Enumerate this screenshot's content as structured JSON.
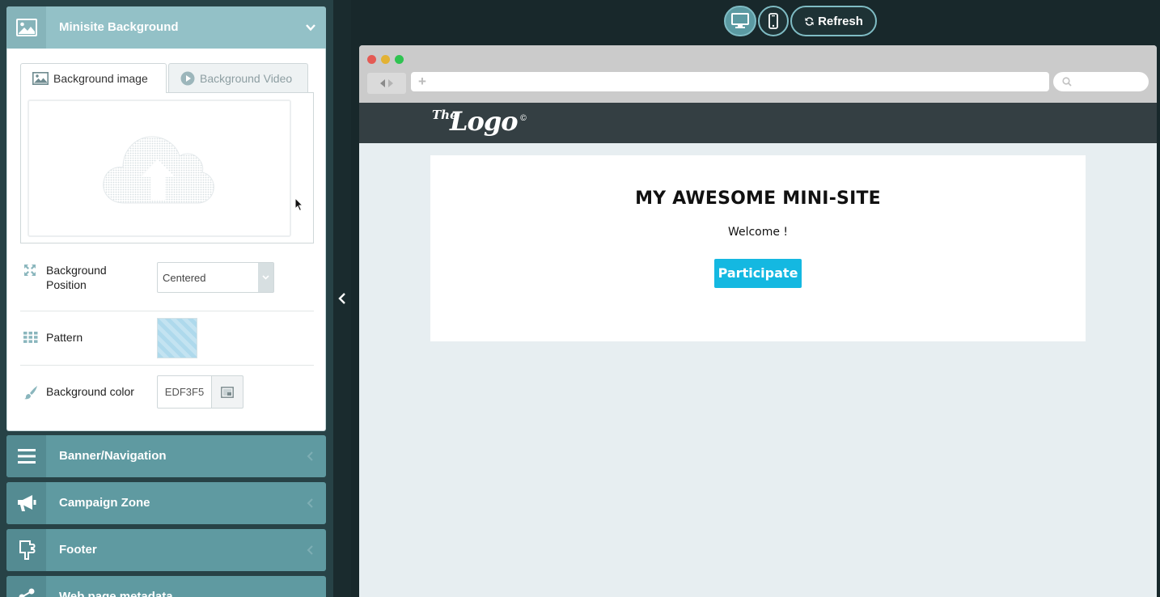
{
  "panel": {
    "sections": [
      {
        "title": "Minisite Background",
        "icon": "image-icon",
        "expanded": true
      },
      {
        "title": "Banner/Navigation",
        "icon": "menu-icon"
      },
      {
        "title": "Campaign Zone",
        "icon": "megaphone-icon"
      },
      {
        "title": "Footer",
        "icon": "footer-icon"
      },
      {
        "title": "Web page metadata",
        "icon": "share-icon"
      }
    ],
    "tabs": {
      "image": "Background image",
      "video": "Background Video"
    },
    "fields": {
      "position_label": "Background Position",
      "position_value": "Centered",
      "pattern_label": "Pattern",
      "color_label": "Background color",
      "color_value": "EDF3F5"
    }
  },
  "toolbar": {
    "refresh_label": "Refresh"
  },
  "preview": {
    "logo_the": "The",
    "logo_main": "Logo",
    "logo_mark": "©",
    "title": "MY AWESOME MINI-SITE",
    "welcome": "Welcome !",
    "cta": "Participate"
  },
  "colors": {
    "accent": "#5f9aa1",
    "cta": "#14b8e1",
    "site_header": "#343f43",
    "site_background": "#EDF3F5"
  }
}
